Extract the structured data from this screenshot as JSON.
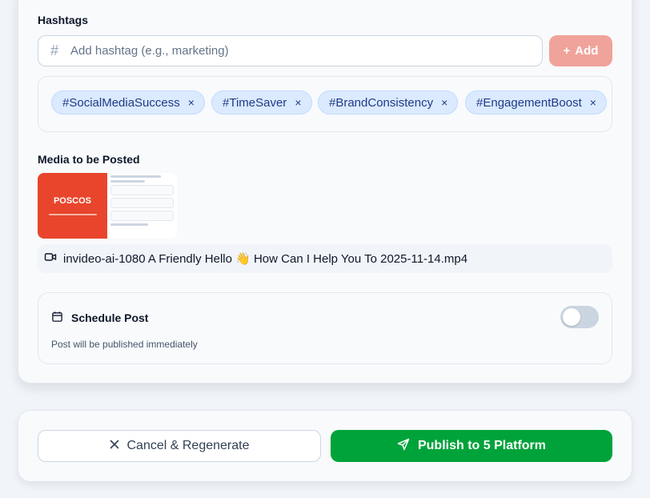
{
  "hashtags": {
    "label": "Hashtags",
    "input_placeholder": "Add hashtag (e.g., marketing)",
    "input_icon": "hash-icon",
    "add_label": "Add",
    "add_icon": "plus-icon",
    "tags": [
      {
        "label": "#SocialMediaSuccess",
        "remove": "×"
      },
      {
        "label": "#TimeSaver",
        "remove": "×"
      },
      {
        "label": "#BrandConsistency",
        "remove": "×"
      },
      {
        "label": "#EngagementBoost",
        "remove": "×"
      }
    ]
  },
  "media": {
    "label": "Media to be Posted",
    "thumbnail_brand": "POSCOS",
    "file_icon": "video-icon",
    "file_name": "invideo-ai-1080 A Friendly Hello 👋 How Can I Help You To 2025-11-14.mp4"
  },
  "schedule": {
    "title": "Schedule Post",
    "icon": "calendar-icon",
    "subtitle": "Post will be published immediately",
    "enabled": false
  },
  "actions": {
    "cancel_label": "Cancel & Regenerate",
    "cancel_icon": "close-icon",
    "publish_label": "Publish to 5 Platform",
    "publish_icon": "send-icon"
  },
  "colors": {
    "publish": "#00a33a",
    "add_disabled": "#f0a39a",
    "tag_bg": "#dbeafe",
    "tag_text": "#1e3a8a"
  }
}
